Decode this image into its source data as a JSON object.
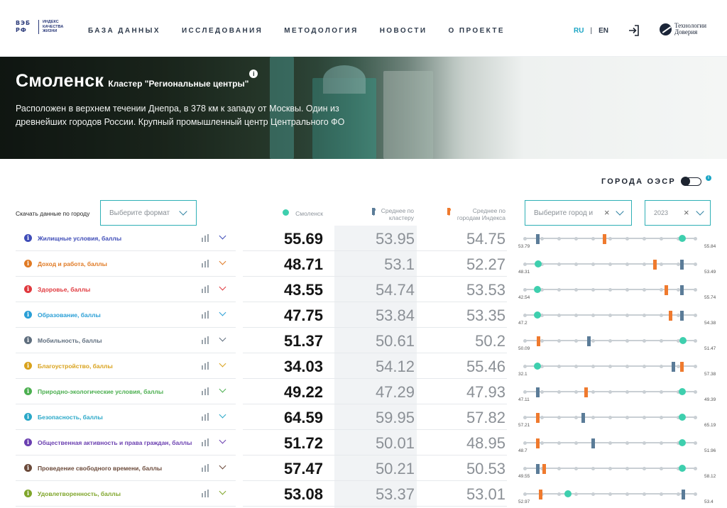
{
  "header": {
    "logo_mark": [
      "ВЭБ",
      "РФ"
    ],
    "logo_text": [
      "ИНДЕКС",
      "КАЧЕСТВА",
      "ЖИЗНИ"
    ],
    "nav": [
      "БАЗА ДАННЫХ",
      "ИССЛЕДОВАНИЯ",
      "МЕТОДОЛОГИЯ",
      "НОВОСТИ",
      "О ПРОЕКТЕ"
    ],
    "lang_ru": "RU",
    "lang_sep": "|",
    "lang_en": "EN",
    "partner": [
      "Технологии",
      "Доверия"
    ]
  },
  "hero": {
    "city": "Смоленск",
    "cluster": "Кластер \"Региональные центры\"",
    "info_glyph": "i",
    "description": "Расположен в верхнем течении Днепра, в 378 км к западу от Москвы. Один из древнейших городов России. Крупный промышленный центр Центрального ФО"
  },
  "oecd": {
    "label": "ГОРОДА ОЭСР",
    "info_glyph": "i",
    "enabled": false
  },
  "controls": {
    "download_label": "Скачать данные по городу",
    "format_placeholder": "Выберите формат",
    "city_placeholder": "Выберите город и",
    "year_value": "2023"
  },
  "columns": {
    "city": "Смоленск",
    "cluster_avg": [
      "Среднее по",
      "кластеру"
    ],
    "index_avg": [
      "Среднее по",
      "городам Индекса"
    ]
  },
  "colors": {
    "accent": "#1aa5c4",
    "city_marker": "#3ecfae",
    "cluster_marker": "#5b7c98",
    "index_marker": "#ef7a2e"
  },
  "indicators": [
    {
      "label": "Жилищные условия, баллы",
      "color": "#3f4db8",
      "city": "55.69",
      "cluster": "53.95",
      "index": "54.75",
      "min": "53.79",
      "max": "55.84"
    },
    {
      "label": "Доход и работа, баллы",
      "color": "#e07a24",
      "city": "48.71",
      "cluster": "53.1",
      "index": "52.27",
      "min": "48.31",
      "max": "53.49"
    },
    {
      "label": "Здоровье, баллы",
      "color": "#e0393e",
      "city": "43.55",
      "cluster": "54.74",
      "index": "53.53",
      "min": "42.54",
      "max": "55.74"
    },
    {
      "label": "Образование, баллы",
      "color": "#2a9fd6",
      "city": "47.75",
      "cluster": "53.84",
      "index": "53.35",
      "min": "47.2",
      "max": "54.38"
    },
    {
      "label": "Мобильность, баллы",
      "color": "#5f6e7e",
      "city": "51.37",
      "cluster": "50.61",
      "index": "50.2",
      "min": "50.09",
      "max": "51.47"
    },
    {
      "label": "Благоустройство, баллы",
      "color": "#d9a21c",
      "city": "34.03",
      "cluster": "54.12",
      "index": "55.46",
      "min": "32.1",
      "max": "57.38"
    },
    {
      "label": "Природно-экологические условия, баллы",
      "color": "#4caf50",
      "city": "49.22",
      "cluster": "47.29",
      "index": "47.93",
      "min": "47.11",
      "max": "49.39"
    },
    {
      "label": "Безопасность, баллы",
      "color": "#2aa8c8",
      "city": "64.59",
      "cluster": "59.95",
      "index": "57.82",
      "min": "57.21",
      "max": "65.19"
    },
    {
      "label": "Общественная активность и права граждан, баллы",
      "color": "#6a3fb0",
      "city": "51.72",
      "cluster": "50.01",
      "index": "48.95",
      "min": "48.7",
      "max": "51.96"
    },
    {
      "label": "Проведение свободного времени, баллы",
      "color": "#6b4a3a",
      "city": "57.47",
      "cluster": "50.21",
      "index": "50.53",
      "min": "49.55",
      "max": "58.12"
    },
    {
      "label": "Удовлетворенность, баллы",
      "color": "#7fa52a",
      "city": "53.08",
      "cluster": "53.37",
      "index": "53.01",
      "min": "52.97",
      "max": "53.4"
    }
  ]
}
